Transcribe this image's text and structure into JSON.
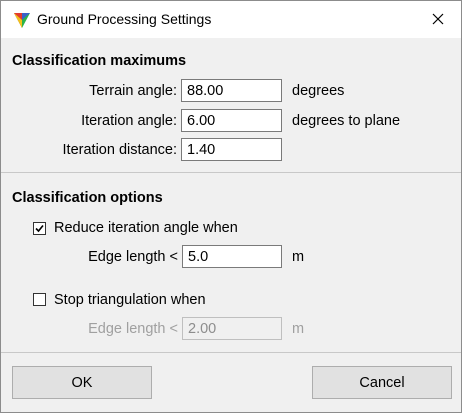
{
  "window": {
    "title": "Ground Processing Settings",
    "app_icon": "triangle-logo-icon",
    "close_icon": "close-icon"
  },
  "classification_maximums": {
    "title": "Classification maximums",
    "terrain_angle": {
      "label": "Terrain angle:",
      "value": "88.00",
      "unit": "degrees"
    },
    "iteration_angle": {
      "label": "Iteration angle:",
      "value": "6.00",
      "unit": "degrees to plane"
    },
    "iteration_distance": {
      "label": "Iteration distance:",
      "value": "1.40"
    }
  },
  "classification_options": {
    "title": "Classification options",
    "reduce_iteration": {
      "label": "Reduce iteration angle when",
      "checked": true,
      "edge_label": "Edge length <",
      "edge_value": "5.0",
      "edge_unit": "m"
    },
    "stop_triangulation": {
      "label": "Stop triangulation when",
      "checked": false,
      "edge_label": "Edge length <",
      "edge_value": "2.00",
      "edge_unit": "m"
    }
  },
  "buttons": {
    "ok": "OK",
    "cancel": "Cancel"
  }
}
